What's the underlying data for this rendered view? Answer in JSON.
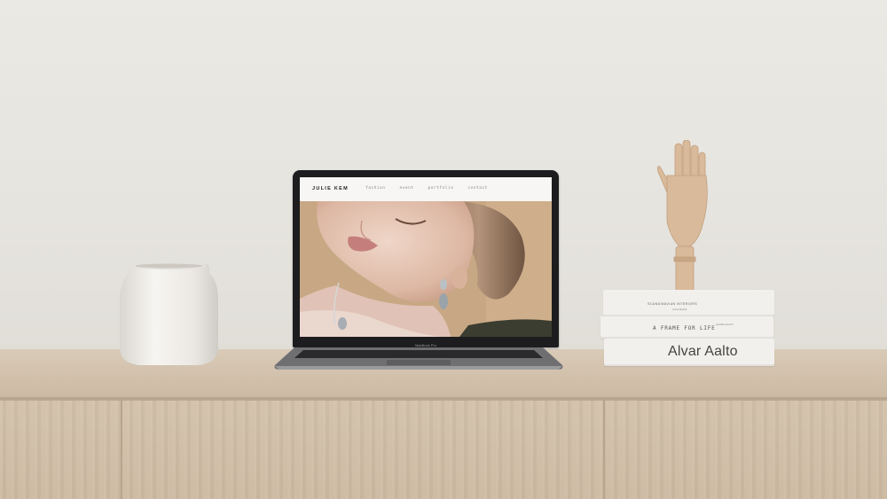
{
  "website": {
    "logo": "JULIE KEM",
    "nav": [
      "fashion",
      "event",
      "portfolio",
      "contact"
    ]
  },
  "laptop": {
    "model_label": "MacBook Pro"
  },
  "books": {
    "top": {
      "title": "SCANDINAVIAN INTERIORS",
      "author": "Anna Rosall"
    },
    "middle": {
      "title": "A FRAME FOR LIFE",
      "subtitle": "ALVAR AALTO"
    },
    "bottom": {
      "title": "Alvar Aalto"
    }
  },
  "colors": {
    "wall": "#e9e7e2",
    "wood": "#d3c2ab",
    "laptop_bezel": "#1d1d1f",
    "hero_background": "#c8a784"
  }
}
